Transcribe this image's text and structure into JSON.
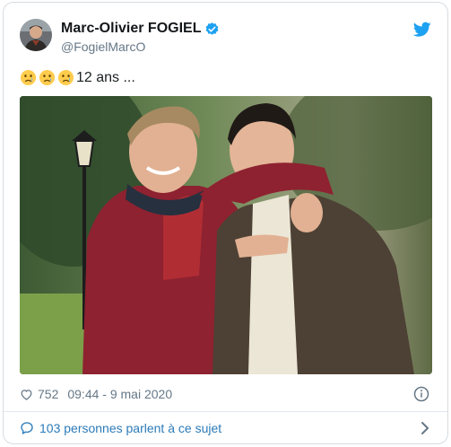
{
  "tweet": {
    "author": {
      "display_name": "Marc-Olivier FOGIEL",
      "handle": "@FogielMarcO",
      "verified": true
    },
    "text_emojis": [
      "crying-face",
      "crying-face",
      "crying-face"
    ],
    "text": "12 ans ...",
    "likes": "752",
    "timestamp": "09:44 - 9 mai 2020",
    "conversation_label": "103 personnes parlent à ce sujet"
  },
  "colors": {
    "accent": "#1da1f2",
    "link": "#2b7bb9",
    "muted": "#657786",
    "border": "#d7dce0"
  },
  "icons": {
    "brand": "twitter-bird-icon",
    "verified": "verified-badge-icon",
    "like": "heart-icon",
    "info": "info-icon",
    "conversation": "speech-bubble-icon",
    "more": "chevron-right-icon"
  }
}
